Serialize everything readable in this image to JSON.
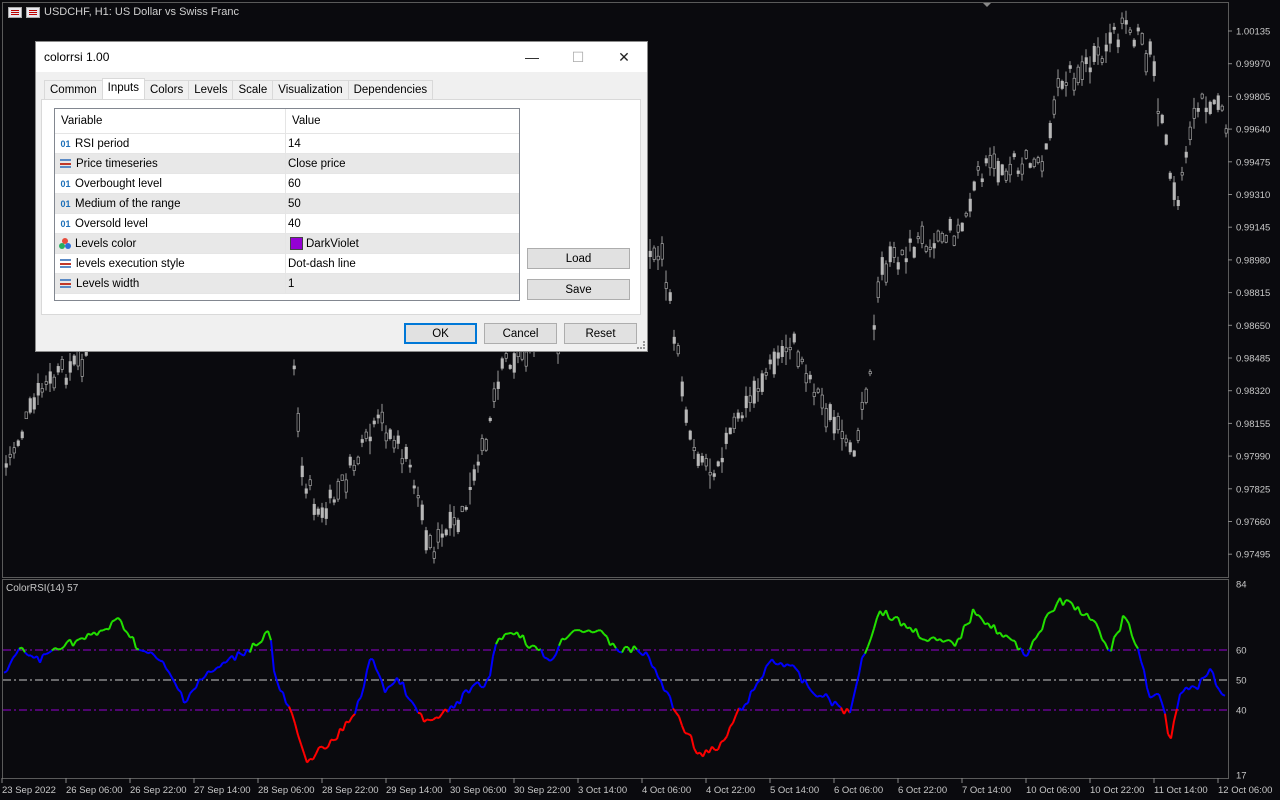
{
  "chart": {
    "title": "USDCHF, H1:  US Dollar vs Swiss Franc",
    "price_axis": [
      "1.00135",
      "0.99970",
      "0.99805",
      "0.99640",
      "0.99475",
      "0.99310",
      "0.99145",
      "0.98980",
      "0.98815",
      "0.98650",
      "0.98485",
      "0.98320",
      "0.98155",
      "0.97990",
      "0.97825",
      "0.97660",
      "0.97495"
    ],
    "time_axis": [
      "23 Sep 2022",
      "26 Sep 06:00",
      "26 Sep 22:00",
      "27 Sep 14:00",
      "28 Sep 06:00",
      "28 Sep 22:00",
      "29 Sep 14:00",
      "30 Sep 06:00",
      "30 Sep 22:00",
      "3 Oct 14:00",
      "4 Oct 06:00",
      "4 Oct 22:00",
      "5 Oct 14:00",
      "6 Oct 06:00",
      "6 Oct 22:00",
      "7 Oct 14:00",
      "10 Oct 06:00",
      "10 Oct 22:00",
      "11 Oct 14:00",
      "12 Oct 06:00"
    ]
  },
  "indicator": {
    "label": "ColorRSI(14) 57",
    "axis": [
      "84",
      "60",
      "50",
      "40",
      "17"
    ],
    "colors": {
      "overbought": "#22e000",
      "normal": "#0000ff",
      "oversold": "#ff0000",
      "level": "#9400d3",
      "mid": "#c8c8c8"
    }
  },
  "dialog": {
    "title": "colorrsi 1.00",
    "controls": {
      "minimize": "—",
      "maximize": "☐",
      "close": "✕"
    },
    "tabs": [
      "Common",
      "Inputs",
      "Colors",
      "Levels",
      "Scale",
      "Visualization",
      "Dependencies"
    ],
    "active_tab": "Inputs",
    "columns": {
      "variable": "Variable",
      "value": "Value"
    },
    "params": [
      {
        "icon": "number-icon",
        "name": "RSI period",
        "value": "14"
      },
      {
        "icon": "list-icon",
        "name": "Price timeseries",
        "value": "Close price"
      },
      {
        "icon": "number-icon",
        "name": "Overbought level",
        "value": "60"
      },
      {
        "icon": "number-icon",
        "name": "Medium of the range",
        "value": "50"
      },
      {
        "icon": "number-icon",
        "name": "Oversold level",
        "value": "40"
      },
      {
        "icon": "color-icon",
        "name": "Levels color",
        "value": "DarkViolet",
        "swatch": "#9400d3"
      },
      {
        "icon": "list-icon",
        "name": "levels execution style",
        "value": "Dot-dash line"
      },
      {
        "icon": "list-icon",
        "name": "Levels width",
        "value": "1"
      }
    ],
    "number_icon_text": "01",
    "buttons": {
      "load": "Load",
      "save": "Save",
      "ok": "OK",
      "cancel": "Cancel",
      "reset": "Reset"
    }
  }
}
